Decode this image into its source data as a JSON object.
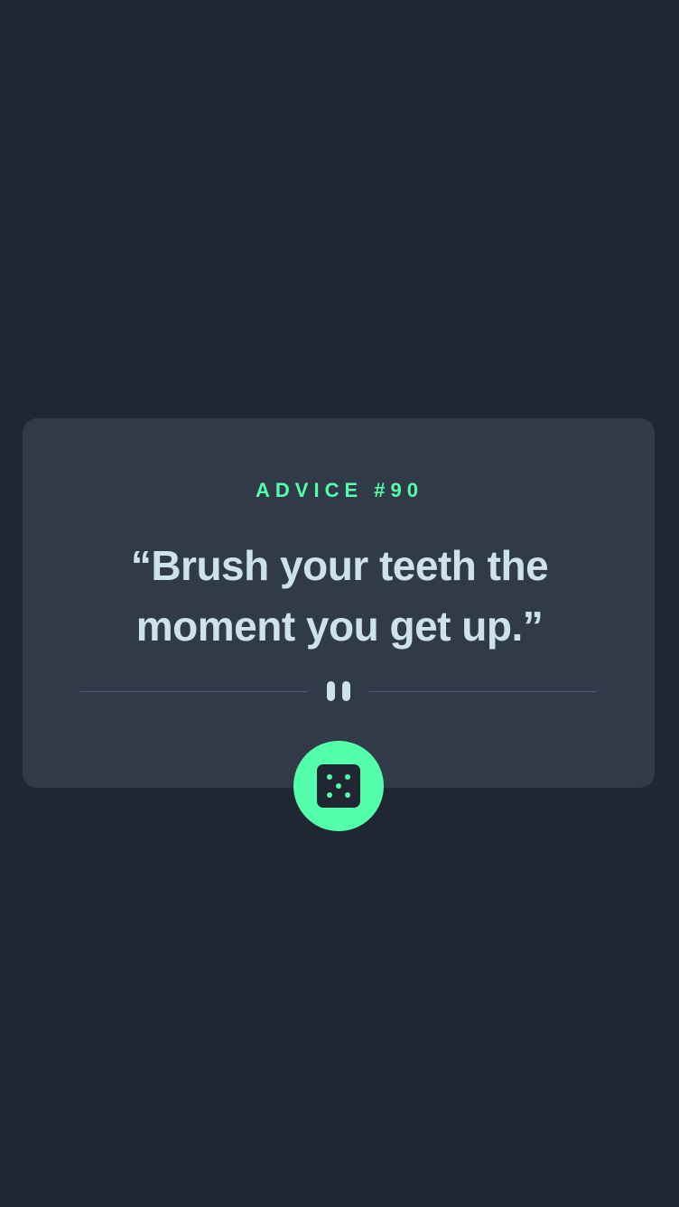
{
  "advice": {
    "label": "ADVICE #90",
    "quote": "“Brush your teeth the moment you get up.”"
  },
  "divider": {
    "icon": "pause-divider-icon"
  },
  "button": {
    "icon": "dice-icon",
    "accent_color": "#53FFAA"
  },
  "colors": {
    "background": "#202733",
    "card": "#313A48",
    "accent": "#53FFAA",
    "text": "#CEE3E9",
    "divider": "#4F5D74"
  }
}
